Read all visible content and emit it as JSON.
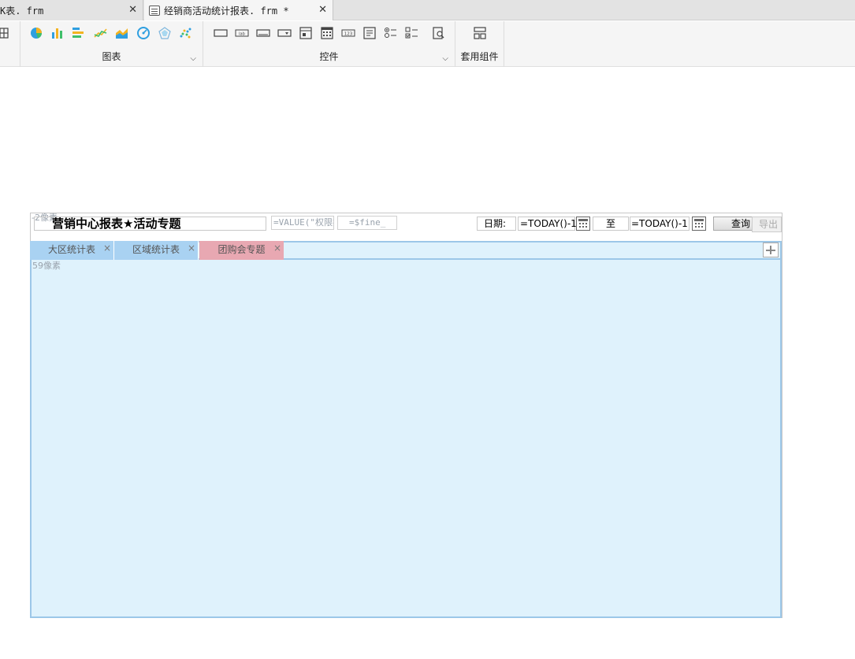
{
  "file_tabs": [
    {
      "label": "K表. frm",
      "active": false
    },
    {
      "label": "经销商活动统计报表. frm *",
      "active": true
    }
  ],
  "ribbon": {
    "groups": [
      {
        "label": "图表"
      },
      {
        "label": "控件"
      },
      {
        "label": "套用组件"
      }
    ],
    "control_icon_text": {
      "lab": "lab",
      "num": "123"
    }
  },
  "report": {
    "top_pixel_label": "-2像素",
    "title": "营销中心报表★活动专题",
    "formula1": "=VALUE(\"权限控",
    "formula2": "=$fine_",
    "date_label": "日期:",
    "date_start": "=TODAY()-1",
    "to_label": "至",
    "date_end": "=TODAY()-1",
    "query_label": "查询",
    "export_label": "导出",
    "tabs": [
      {
        "label": "大区统计表"
      },
      {
        "label": "区域统计表"
      },
      {
        "label": "团购会专题"
      }
    ],
    "tab_close": "×",
    "body_pixel_label": "59像素"
  },
  "colors": {
    "panel_bg": "#dff2fc",
    "panel_border": "#9cc7e8",
    "tab_blue": "#a9d2f2",
    "tab_pink": "#e8a8b2"
  }
}
